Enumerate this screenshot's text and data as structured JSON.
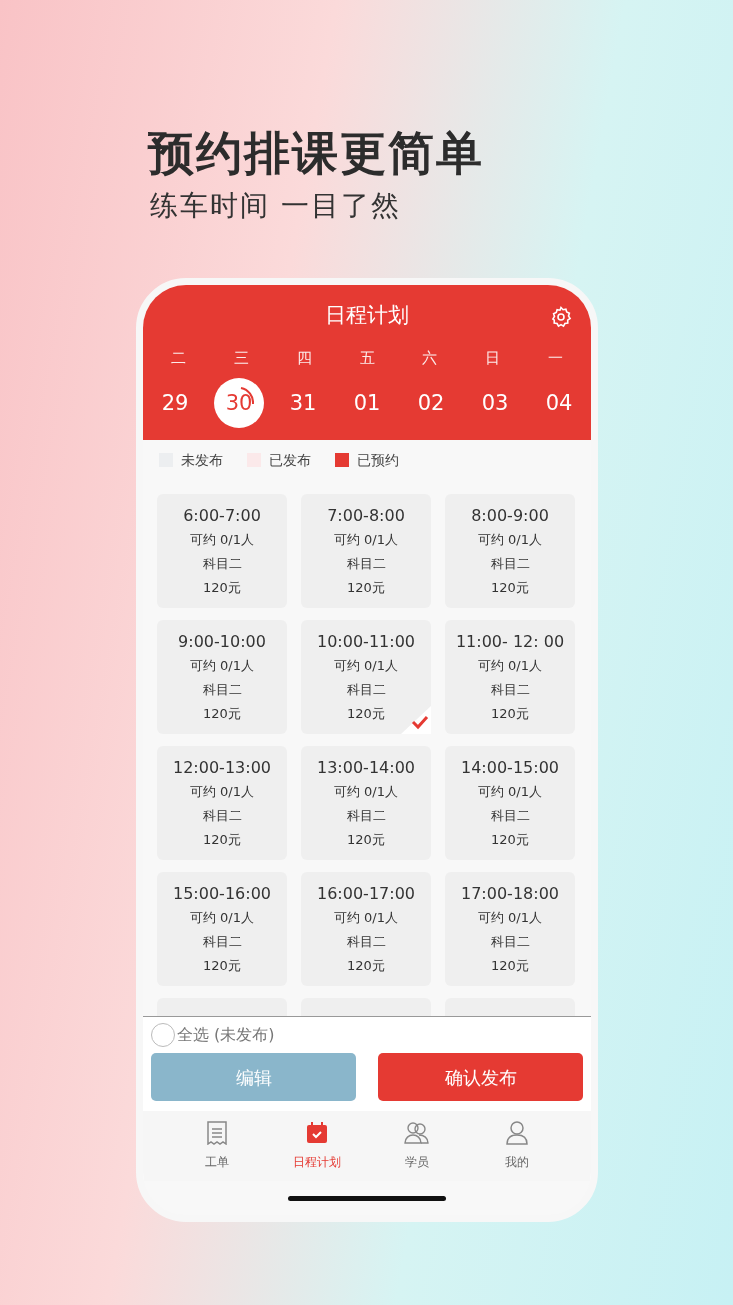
{
  "headline": "预约排课更简单",
  "subheadline": "练车时间 一目了然",
  "app": {
    "title": "日程计划",
    "days": [
      {
        "weekday": "二",
        "date": "29",
        "selected": false
      },
      {
        "weekday": "三",
        "date": "30",
        "selected": true
      },
      {
        "weekday": "四",
        "date": "31",
        "selected": false
      },
      {
        "weekday": "五",
        "date": "01",
        "selected": false
      },
      {
        "weekday": "六",
        "date": "02",
        "selected": false
      },
      {
        "weekday": "日",
        "date": "03",
        "selected": false
      },
      {
        "weekday": "一",
        "date": "04",
        "selected": false
      }
    ],
    "legend": [
      {
        "label": "未发布",
        "color": "#eceef0"
      },
      {
        "label": "已发布",
        "color": "#fbe9ea"
      },
      {
        "label": "已预约",
        "color": "#e53a33"
      }
    ],
    "slots": [
      {
        "kind": "full",
        "time": "6:00-7:00",
        "capacity": "可约 0/1人",
        "subject": "科目二",
        "price": "120元",
        "selected": false
      },
      {
        "kind": "full",
        "time": "7:00-8:00",
        "capacity": "可约 0/1人",
        "subject": "科目二",
        "price": "120元",
        "selected": false
      },
      {
        "kind": "full",
        "time": "8:00-9:00",
        "capacity": "可约 0/1人",
        "subject": "科目二",
        "price": "120元",
        "selected": false
      },
      {
        "kind": "full",
        "time": "9:00-10:00",
        "capacity": "可约 0/1人",
        "subject": "科目二",
        "price": "120元",
        "selected": false
      },
      {
        "kind": "full",
        "time": "10:00-11:00",
        "capacity": "可约 0/1人",
        "subject": "科目二",
        "price": "120元",
        "selected": true
      },
      {
        "kind": "full",
        "time": "11:00- 12: 00",
        "capacity": "可约 0/1人",
        "subject": "科目二",
        "price": "120元",
        "selected": false
      },
      {
        "kind": "full",
        "time": "12:00-13:00",
        "capacity": "可约 0/1人",
        "subject": "科目二",
        "price": "120元",
        "selected": false
      },
      {
        "kind": "full",
        "time": "13:00-14:00",
        "capacity": "可约 0/1人",
        "subject": "科目二",
        "price": "120元",
        "selected": false
      },
      {
        "kind": "full",
        "time": "14:00-15:00",
        "capacity": "可约 0/1人",
        "subject": "科目二",
        "price": "120元",
        "selected": false
      },
      {
        "kind": "full",
        "time": "15:00-16:00",
        "capacity": "可约 0/1人",
        "subject": "科目二",
        "price": "120元",
        "selected": false
      },
      {
        "kind": "full",
        "time": "16:00-17:00",
        "capacity": "可约 0/1人",
        "subject": "科目二",
        "price": "120元",
        "selected": false
      },
      {
        "kind": "full",
        "time": "17:00-18:00",
        "capacity": "可约 0/1人",
        "subject": "科目二",
        "price": "120元",
        "selected": false
      },
      {
        "kind": "cut"
      },
      {
        "kind": "cut"
      },
      {
        "kind": "cut"
      }
    ],
    "select_all": {
      "label": "全选 (未发布)",
      "checked": false
    },
    "buttons": [
      {
        "label": "编辑",
        "kind": "secondary"
      },
      {
        "label": "确认发布",
        "kind": "primary"
      }
    ],
    "tabs": [
      {
        "label": "工单",
        "selected": false
      },
      {
        "label": "日程计划",
        "selected": true
      },
      {
        "label": "学员",
        "selected": false
      },
      {
        "label": "我的",
        "selected": false
      }
    ]
  }
}
